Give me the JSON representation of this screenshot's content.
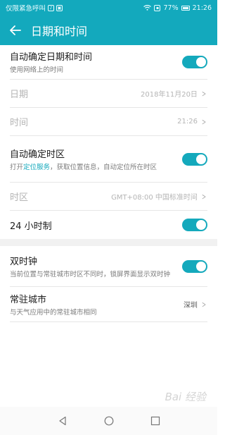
{
  "statusbar": {
    "carrier": "仅限紧急呼叫",
    "battery": "77%",
    "time": "21:26"
  },
  "appbar": {
    "title": "日期和时间"
  },
  "rows": {
    "auto_datetime": {
      "title": "自动确定日期和时间",
      "subtitle": "使用网络上的时间",
      "enabled": true
    },
    "date": {
      "title": "日期",
      "value": "2018年11月20日"
    },
    "time": {
      "title": "时间",
      "value": "21:26"
    },
    "auto_tz": {
      "title": "自动确定时区",
      "sub_prefix": "打开",
      "sub_link": "定位服务",
      "sub_suffix": "，获取位置信息，自动定位所在时区",
      "enabled": true
    },
    "timezone": {
      "title": "时区",
      "value": "GMT+08:00 中国标准时间"
    },
    "hour24": {
      "title": "24 小时制",
      "enabled": true
    },
    "dual_clock": {
      "title": "双时钟",
      "subtitle": "当前位置与常驻城市时区不同时，锁屏界面显示双时钟",
      "enabled": true
    },
    "home_city": {
      "title": "常驻城市",
      "subtitle": "与天气应用中的常驻城市相同",
      "value": "深圳"
    }
  },
  "watermark": "Bai 经验",
  "colors": {
    "accent": "#13a9bd"
  }
}
